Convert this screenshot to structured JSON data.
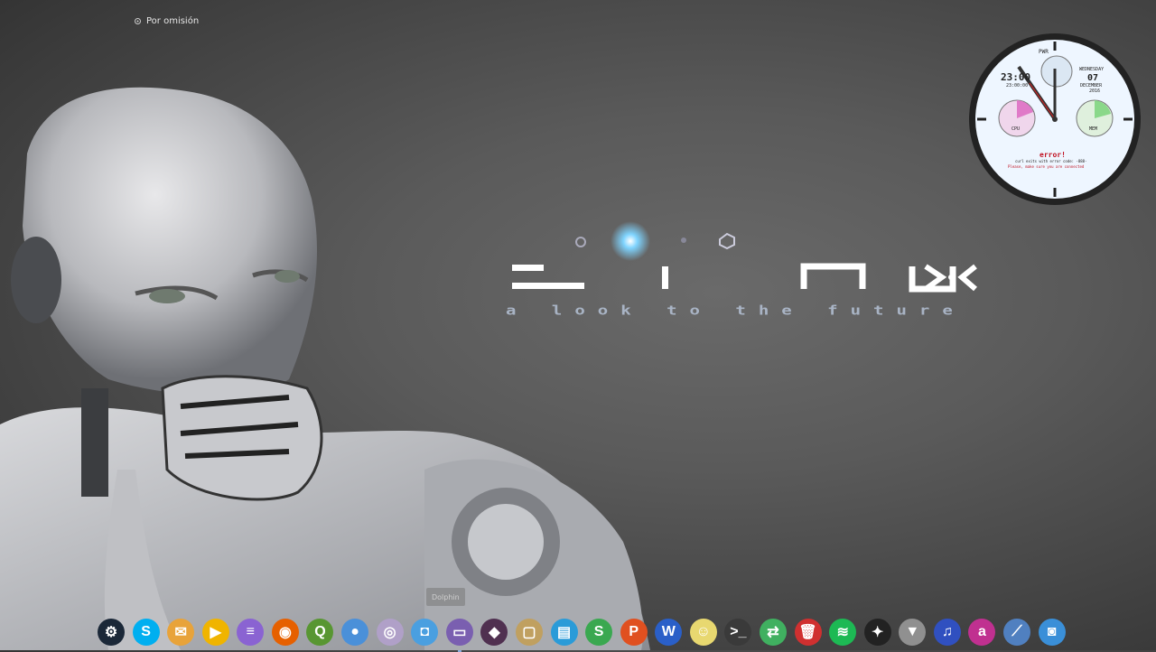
{
  "desktop": {
    "activity_label": "Por omisión",
    "logo_text": "LINUX",
    "tagline": "a look to the future"
  },
  "clock_widget": {
    "time": "23:00",
    "small_time": "23:00:00",
    "weekday": "WEDNESDAY",
    "day": "07",
    "month": "DECEMBER",
    "year": "2016",
    "pwr_label": "PWR",
    "cpu_label": "CPU",
    "mem_label": "MEM",
    "error_title": "error!",
    "error_line1": "curl exits with error code: -888-",
    "error_line2": "Please, make sure you are connected"
  },
  "tooltip": "Dolphin",
  "dock": [
    {
      "name": "steam",
      "glyph": "⚙",
      "color": "#1b2838"
    },
    {
      "name": "skype",
      "glyph": "S",
      "color": "#00aff0"
    },
    {
      "name": "mail",
      "glyph": "✉",
      "color": "#e8a33a"
    },
    {
      "name": "media-player",
      "glyph": "▶",
      "color": "#f0b400"
    },
    {
      "name": "text-editor",
      "glyph": "≡",
      "color": "#8a63d2"
    },
    {
      "name": "firefox",
      "glyph": "◉",
      "color": "#e66000"
    },
    {
      "name": "qgis",
      "glyph": "Q",
      "color": "#589632"
    },
    {
      "name": "chromium",
      "glyph": "●",
      "color": "#4a90d9"
    },
    {
      "name": "cheese",
      "glyph": "◎",
      "color": "#b0a0c8"
    },
    {
      "name": "screenshot",
      "glyph": "◘",
      "color": "#4a9fe0"
    },
    {
      "name": "dolphin",
      "glyph": "▭",
      "color": "#7a5fb0"
    },
    {
      "name": "game",
      "glyph": "◆",
      "color": "#503050"
    },
    {
      "name": "gallery",
      "glyph": "▢",
      "color": "#c0a060"
    },
    {
      "name": "monitor",
      "glyph": "▤",
      "color": "#2a9bd8"
    },
    {
      "name": "spreadsheet",
      "glyph": "S",
      "color": "#3aa850"
    },
    {
      "name": "presentation",
      "glyph": "P",
      "color": "#e05020"
    },
    {
      "name": "writer",
      "glyph": "W",
      "color": "#2a5fc8"
    },
    {
      "name": "ghost",
      "glyph": "☺",
      "color": "#e8d870"
    },
    {
      "name": "terminal",
      "glyph": ">_",
      "color": "#3a3a3a"
    },
    {
      "name": "settings",
      "glyph": "⇄",
      "color": "#40b060"
    },
    {
      "name": "trash",
      "glyph": "🗑",
      "color": "#d03030"
    },
    {
      "name": "spotify",
      "glyph": "≋",
      "color": "#1db954"
    },
    {
      "name": "inkscape",
      "glyph": "✦",
      "color": "#222222"
    },
    {
      "name": "wolf",
      "glyph": "▼",
      "color": "#909090"
    },
    {
      "name": "music",
      "glyph": "♫",
      "color": "#3050c0"
    },
    {
      "name": "audacity",
      "glyph": "a",
      "color": "#c03090"
    },
    {
      "name": "dragon",
      "glyph": "⟋",
      "color": "#5080c0"
    },
    {
      "name": "camera",
      "glyph": "◙",
      "color": "#3a8fd8"
    }
  ],
  "colors": {
    "background": "#5a5a5a",
    "clock_face": "#eef6ff",
    "logo": "#ffffff",
    "tagline": "#b5c2d6"
  }
}
